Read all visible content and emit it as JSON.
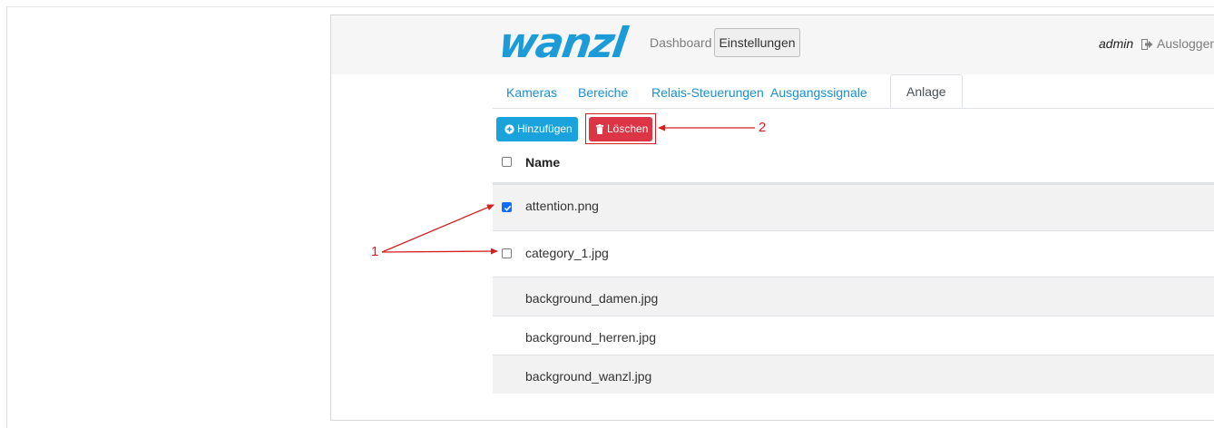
{
  "header": {
    "logo": "wanzl",
    "nav_dashboard": "Dashboard",
    "nav_settings": "Einstellungen",
    "user": "admin",
    "logout": "Ausloggen"
  },
  "tabs": [
    {
      "label": "Kameras",
      "active": false
    },
    {
      "label": "Bereiche",
      "active": false
    },
    {
      "label": "Relais-Steuerungen",
      "active": false
    },
    {
      "label": "Ausgangssignale",
      "active": false
    },
    {
      "label": "Anlage",
      "active": true
    }
  ],
  "toolbar": {
    "add_label": "Hinzufügen",
    "delete_label": "Löschen"
  },
  "table": {
    "header_name": "Name",
    "rows": [
      {
        "name": "attention.png",
        "checked": true
      },
      {
        "name": "category_1.jpg",
        "checked": false
      },
      {
        "name": "background_damen.jpg"
      },
      {
        "name": "background_herren.jpg"
      },
      {
        "name": "background_wanzl.jpg"
      }
    ]
  },
  "annotations": {
    "label_1": "1",
    "label_2": "2"
  },
  "colors": {
    "brand": "#1b9bd7",
    "link": "#1b8fd3",
    "danger": "#dc3545",
    "primary": "#1aa2dc",
    "annotation": "#d21f1f"
  }
}
